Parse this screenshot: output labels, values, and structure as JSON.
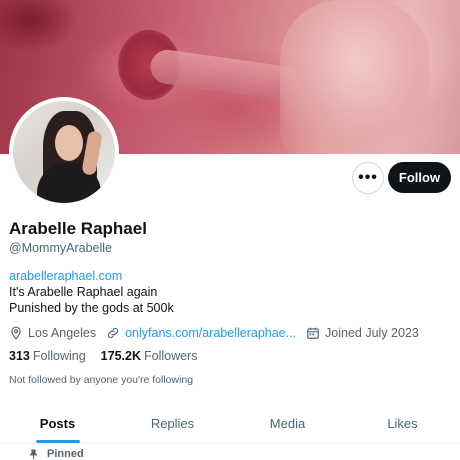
{
  "profile": {
    "name": "Arabelle Raphael",
    "handle": "@MommyArabelle",
    "website": "arabelleraphael.com",
    "bio_lines": [
      "It's Arabelle Raphael again",
      "Punished by the gods at 500k"
    ],
    "location": "Los Angeles",
    "link": "onlyfans.com/arabelleraphae...",
    "joined": "Joined July 2023",
    "following_count": "313",
    "following_label": "Following",
    "followers_count": "175.2K",
    "followers_label": "Followers",
    "not_followed_text": "Not followed by anyone you're following"
  },
  "actions": {
    "more_label": "•••",
    "follow_label": "Follow"
  },
  "tabs": [
    {
      "label": "Posts",
      "active": true
    },
    {
      "label": "Replies",
      "active": false
    },
    {
      "label": "Media",
      "active": false
    },
    {
      "label": "Likes",
      "active": false
    }
  ],
  "pinned_label": "Pinned",
  "icons": {
    "location": "location-pin-icon",
    "link": "link-icon",
    "calendar": "calendar-icon",
    "pin": "pin-icon",
    "more": "more-icon"
  },
  "colors": {
    "accent": "#1d9bf0",
    "text_primary": "#0f1419",
    "text_secondary": "#536471",
    "follow_bg": "#0f1419"
  }
}
